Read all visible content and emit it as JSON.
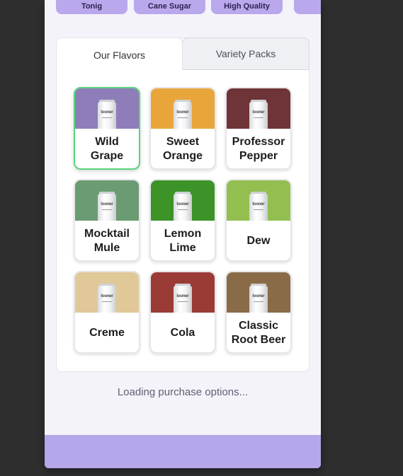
{
  "chips": [
    {
      "label": "Tonig"
    },
    {
      "label": "Cane Sugar"
    },
    {
      "label": "High Quality"
    },
    {
      "label": ""
    }
  ],
  "tabs": {
    "active": "Our Flavors",
    "inactive": "Variety Packs"
  },
  "can_logo": "looner",
  "flavors": [
    {
      "name": "Wild Grape",
      "color": "#8f7db9",
      "selected": true
    },
    {
      "name": "Sweet Orange",
      "color": "#e8a63a",
      "selected": false
    },
    {
      "name": "Professor Pepper",
      "color": "#6e3437",
      "selected": false
    },
    {
      "name": "Mocktail Mule",
      "color": "#6a9b72",
      "selected": false
    },
    {
      "name": "Lemon Lime",
      "color": "#3c9328",
      "selected": false
    },
    {
      "name": "Dew",
      "color": "#93bf51",
      "selected": false
    },
    {
      "name": "Creme",
      "color": "#e0c898",
      "selected": false
    },
    {
      "name": "Cola",
      "color": "#9b3b36",
      "selected": false
    },
    {
      "name": "Classic Root Beer",
      "color": "#8a6b47",
      "selected": false
    }
  ],
  "status": {
    "loading_text": "Loading purchase options..."
  },
  "colors": {
    "background": "#2e2e2e",
    "panel": "#f5f3fa",
    "accent": "#b6a6ea",
    "selected_border": "#58d47d"
  }
}
